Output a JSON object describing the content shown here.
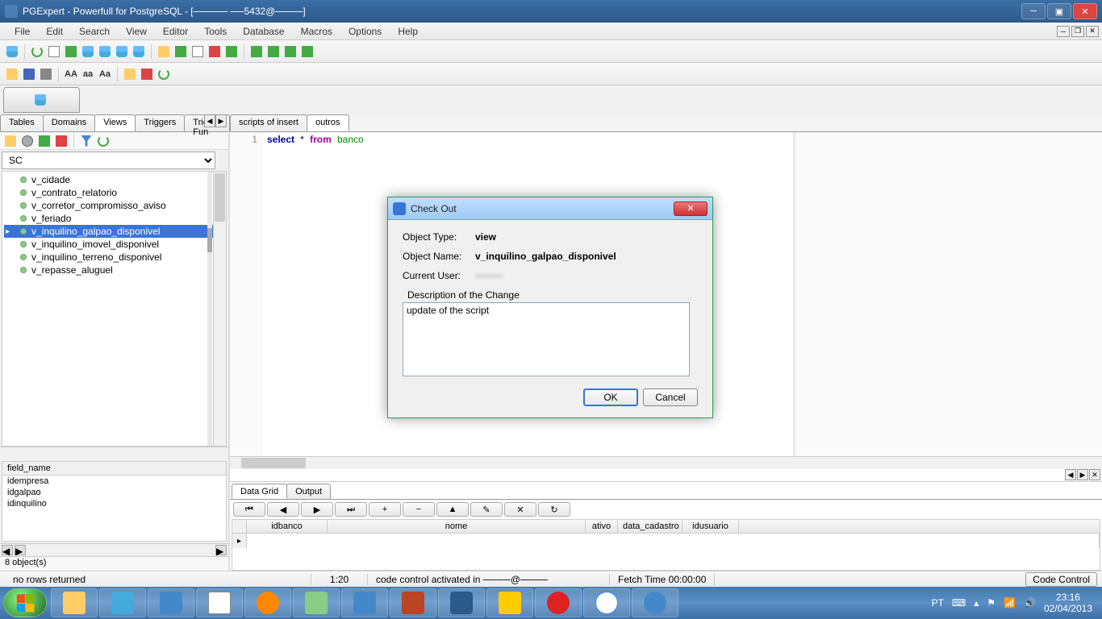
{
  "titlebar": {
    "text": "PGExpert - Powerfull for PostgreSQL - [───── ──5432@────]"
  },
  "menubar": {
    "items": [
      "File",
      "Edit",
      "Search",
      "View",
      "Editor",
      "Tools",
      "Database",
      "Macros",
      "Options",
      "Help"
    ]
  },
  "db_selector": {
    "label": "───"
  },
  "left_tabs": {
    "items": [
      "Tables",
      "Domains",
      "Views",
      "Triggers",
      "Trigger Fun"
    ],
    "active": "Views"
  },
  "schema": {
    "value": "SC"
  },
  "tree": {
    "items": [
      "v_cidade",
      "v_contrato_relatorio",
      "v_corretor_compromisso_aviso",
      "v_feriado",
      "v_inquilino_galpao_disponivel",
      "v_inquilino_imovel_disponivel",
      "v_inquilino_terreno_disponivel",
      "v_repasse_aluguel"
    ],
    "selected_index": 4
  },
  "fields": {
    "header": "field_name",
    "items": [
      "idempresa",
      "idgalpao",
      "idinquilino"
    ]
  },
  "editor_tabs": {
    "items": [
      "scripts of insert",
      "outros"
    ],
    "active": "outros"
  },
  "editor": {
    "line": "1",
    "kw_select": "select",
    "star": "*",
    "kw_from": "from",
    "ident": "banco"
  },
  "grid": {
    "tabs": [
      "Data Grid",
      "Output"
    ],
    "active_tab": "Data Grid",
    "nav_btns": [
      "⏮",
      "◀",
      "▶",
      "⏭",
      "+",
      "−",
      "▲",
      "✎",
      "✕",
      "↻"
    ],
    "columns": [
      "idbanco",
      "nome",
      "ativo",
      "data_cadastro",
      "idusuario"
    ]
  },
  "countbar": {
    "text": "8 object(s)"
  },
  "statusbar": {
    "rows": "no rows returned",
    "pos": "1:20",
    "vc": "code control activated in ────@────",
    "fetch": "Fetch Time 00:00:00",
    "button": "Code Control"
  },
  "dialog": {
    "title": "Check Out",
    "object_type_label": "Object Type:",
    "object_type_value": "view",
    "object_name_label": "Object Name:",
    "object_name_value": "v_inquilino_galpao_disponivel",
    "current_user_label": "Current User:",
    "current_user_value": "────",
    "desc_label": "Description of the Change",
    "desc_value": "update of the script",
    "ok": "OK",
    "cancel": "Cancel"
  },
  "taskbar": {
    "lang": "PT",
    "time": "23:16",
    "date": "02/04/2013"
  },
  "toolbar2": {
    "aa_upper": "AA",
    "aa_lower": "aa",
    "aa_mixed": "Aa"
  }
}
